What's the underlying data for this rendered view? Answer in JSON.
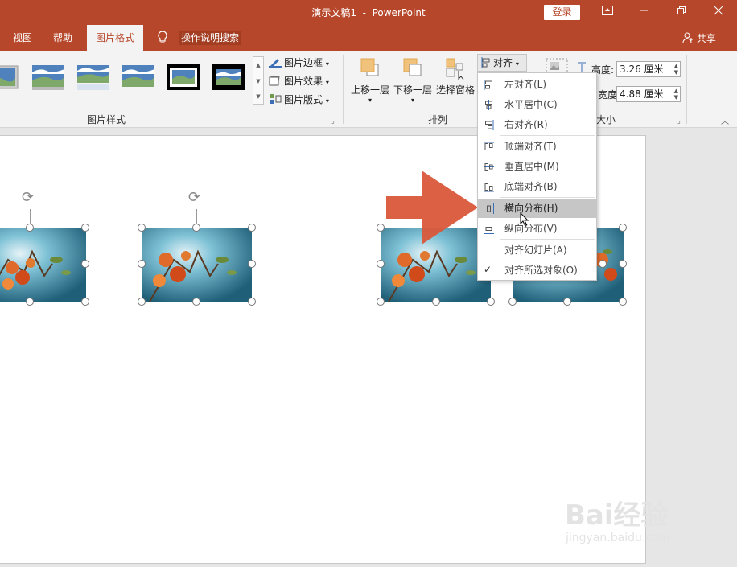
{
  "window": {
    "title_doc": "演示文稿1",
    "title_sep": "-",
    "title_app": "PowerPoint",
    "login_label": "登录",
    "brand_color": "#b7472a"
  },
  "tabs": [
    {
      "label": "视图",
      "active": false
    },
    {
      "label": "帮助",
      "active": false
    },
    {
      "label": "图片格式",
      "active": true
    }
  ],
  "tell_me": "操作说明搜索",
  "share_label": "共享",
  "ribbon": {
    "picture_styles_label": "图片样式",
    "picture_border": "图片边框",
    "picture_effects": "图片效果",
    "picture_layout": "图片版式",
    "arrange_label": "排列",
    "bring_forward": "上移一层",
    "send_backward": "下移一层",
    "selection_pane": "选择窗格",
    "align_label": "对齐",
    "size_label": "大小",
    "height_label": "高度:",
    "height_value": "3.26 厘米",
    "width_label": "宽度:",
    "width_value": "4.88 厘米"
  },
  "align_menu": {
    "items": [
      {
        "label": "左对齐(L)",
        "icon": "align-left-icon"
      },
      {
        "label": "水平居中(C)",
        "icon": "align-center-icon"
      },
      {
        "label": "右对齐(R)",
        "icon": "align-right-icon"
      },
      {
        "label": "顶端对齐(T)",
        "icon": "align-top-icon"
      },
      {
        "label": "垂直居中(M)",
        "icon": "align-middle-icon"
      },
      {
        "label": "底端对齐(B)",
        "icon": "align-bottom-icon"
      },
      {
        "label": "横向分布(H)",
        "icon": "distribute-horizontal-icon",
        "highlighted": true
      },
      {
        "label": "纵向分布(V)",
        "icon": "distribute-vertical-icon"
      },
      {
        "label": "对齐幻灯片(A)",
        "icon": ""
      },
      {
        "label": "对齐所选对象(O)",
        "icon": "checkmark-icon",
        "checked": true
      }
    ]
  },
  "watermark": {
    "main": "Bai经验",
    "sub": "jingyan.baidu.com"
  }
}
